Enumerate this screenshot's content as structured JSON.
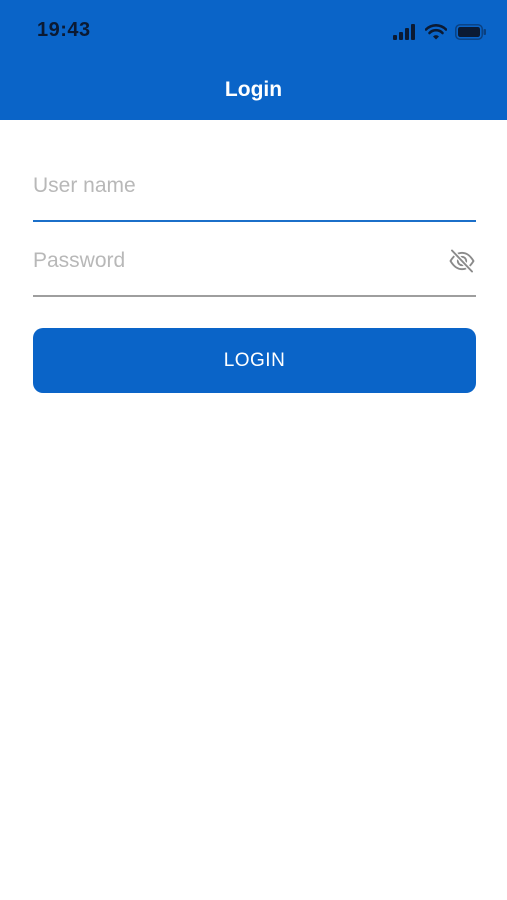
{
  "status_bar": {
    "time": "19:43",
    "icons": [
      "cellular-signal-icon",
      "wifi-icon",
      "battery-icon"
    ]
  },
  "nav": {
    "title": "Login"
  },
  "form": {
    "username": {
      "value": "",
      "placeholder": "User name"
    },
    "password": {
      "value": "",
      "placeholder": "Password",
      "toggle_icon": "eye-slash-icon"
    },
    "login_label": "LOGIN"
  },
  "colors": {
    "primary": "#0a64c8",
    "focused_underline": "#1b6fc9",
    "idle_underline": "#9e9e9e",
    "placeholder": "#b8b8b8",
    "status_text": "#0b1a33"
  }
}
